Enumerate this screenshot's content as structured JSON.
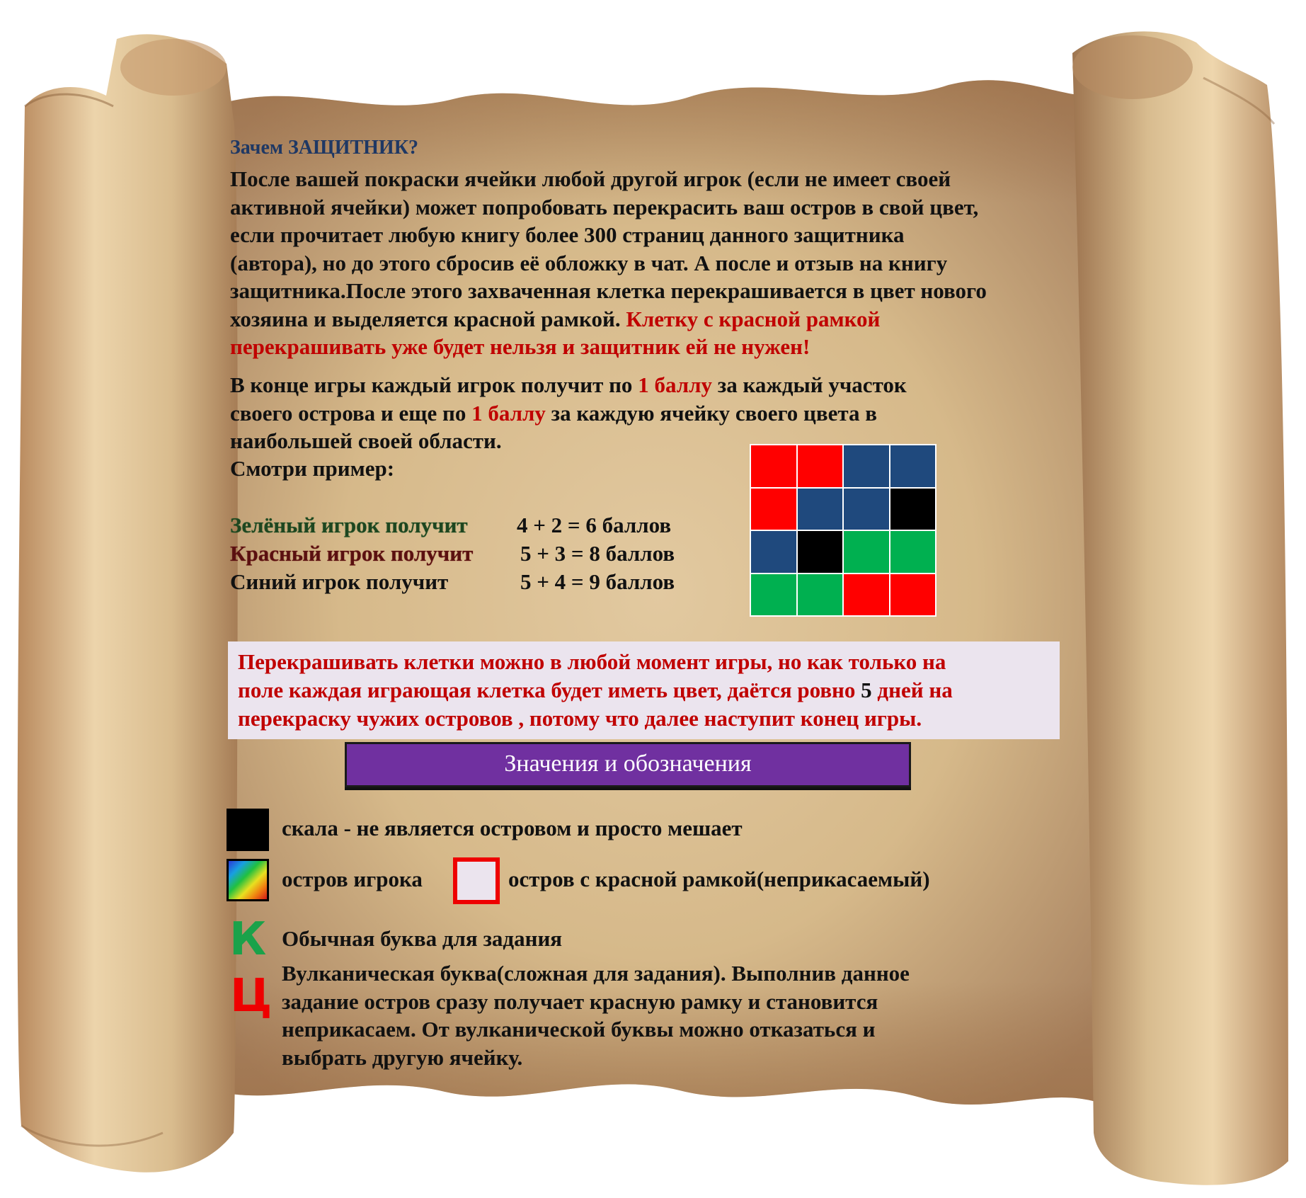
{
  "colors": {
    "red": "#ff0000",
    "blue": "#1f497d",
    "black": "#000000",
    "green": "#00b050",
    "accent_red": "#c00000",
    "title_blue": "#1f3864",
    "banner_purple": "#7030a0",
    "notice_bg": "#ebe4ee"
  },
  "rules": {
    "title": "Зачем ЗАЩИТНИК?",
    "para1": {
      "lines": [
        "После вашей покраски ячейки любой другой игрок (если не имеет своей",
        "активной ячейки) может попробовать  перекрасить ваш остров в свой цвет,",
        "если прочитает любую книгу более 300 страниц данного защитника",
        "(автора), но до этого сбросив её обложку в чат. А после  и отзыв на книгу",
        "защитника.После этого захваченная клетка перекрашивается в цвет нового"
      ],
      "line6_start": "хозяина и выделяется красной рамкой. ",
      "line6_red": "Клетку с красной рамкой",
      "line7_red": "перекрашивать уже будет нельзя и защитник ей не нужен!"
    },
    "para2": {
      "l1_a": "В конце игры каждый игрок получит по ",
      "l1_b": "1 баллу",
      "l1_c": " за каждый участок",
      "l2_a": "своего острова и еще  по ",
      "l2_b": "1 баллу",
      "l2_c": " за каждую ячейку своего цвета в",
      "l3": "наибольшей своей области."
    },
    "see_example": "Смотри пример:"
  },
  "scores": {
    "green": {
      "label": "Зелёный игрок получит",
      "calc": "4 + 2 = 6 баллов"
    },
    "red": {
      "label": "Красный игрок получит",
      "calc": "5 + 3 = 8 баллов"
    },
    "blue": {
      "label": "Синий игрок получит",
      "calc": "5 + 4 = 9 баллов"
    }
  },
  "example_grid": [
    [
      "red",
      "red",
      "blue",
      "blue"
    ],
    [
      "red",
      "blue",
      "blue",
      "black"
    ],
    [
      "blue",
      "black",
      "green",
      "green"
    ],
    [
      "green",
      "green",
      "red",
      "red"
    ]
  ],
  "notice": {
    "l1": "Перекрашивать клетки можно в любой момент игры, но как только на",
    "l2_a": "поле каждая играющая клетка будет иметь цвет, даётся  ровно ",
    "l2_b": "5",
    "l2_c": " дней на",
    "l3": "перекраску чужих островов , потому что далее наступит конец игры."
  },
  "legend": {
    "title": "Значения и обозначения",
    "rock": "скала - не является островом и просто мешает",
    "player_island": "остров игрока",
    "red_frame_island": "остров с красной рамкой(неприкасаемый)",
    "normal_letter": "К",
    "normal_letter_text": "Обычная буква для задания",
    "volcanic_letter": "Ц",
    "volcanic_lines": [
      "Вулканическая буква(сложная для задания). Выполнив данное",
      "задание остров сразу получает красную рамку и становится",
      "неприкасаем. От вулканической буквы можно отказаться и",
      "выбрать другую ячейку."
    ]
  }
}
